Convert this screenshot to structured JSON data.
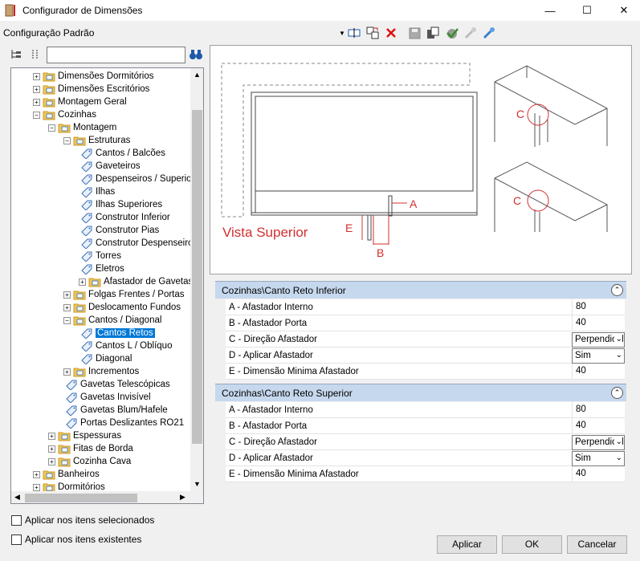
{
  "window": {
    "title": "Configurador de Dimensões",
    "minimize": "—",
    "maximize": "☐",
    "close": "✕"
  },
  "config_label": "Configuração Padrão",
  "tree": {
    "search_value": "",
    "items": [
      {
        "label": "Dimensões Dormitórios",
        "level": 1,
        "exp": "+"
      },
      {
        "label": "Dimensões Escritórios",
        "level": 1,
        "exp": "+"
      },
      {
        "label": "Montagem Geral",
        "level": 1,
        "exp": "+"
      },
      {
        "label": "Cozinhas",
        "level": 1,
        "exp": "−"
      },
      {
        "label": "Montagem",
        "level": 2,
        "exp": "−"
      },
      {
        "label": "Estruturas",
        "level": 3,
        "exp": "−"
      },
      {
        "label": "Cantos / Balcões",
        "level": 4,
        "leaf": true
      },
      {
        "label": "Gaveteiros",
        "level": 4,
        "leaf": true
      },
      {
        "label": "Despenseiros / Superiores",
        "level": 4,
        "leaf": true
      },
      {
        "label": "Ilhas",
        "level": 4,
        "leaf": true
      },
      {
        "label": "Ilhas Superiores",
        "level": 4,
        "leaf": true
      },
      {
        "label": "Construtor Inferior",
        "level": 4,
        "leaf": true
      },
      {
        "label": "Construtor Pias",
        "level": 4,
        "leaf": true
      },
      {
        "label": "Construtor Despenseiros",
        "level": 4,
        "leaf": true
      },
      {
        "label": "Torres",
        "level": 4,
        "leaf": true
      },
      {
        "label": "Eletros",
        "level": 4,
        "leaf": true
      },
      {
        "label": "Afastador de Gavetas",
        "level": 4,
        "exp": "+"
      },
      {
        "label": "Folgas Frentes / Portas",
        "level": 3,
        "exp": "+"
      },
      {
        "label": "Deslocamento Fundos",
        "level": 3,
        "exp": "+"
      },
      {
        "label": "Cantos / Diagonal",
        "level": 3,
        "exp": "−"
      },
      {
        "label": "Cantos Retos",
        "level": 4,
        "leaf": true,
        "selected": true
      },
      {
        "label": "Cantos L / Oblíquo",
        "level": 4,
        "leaf": true
      },
      {
        "label": "Diagonal",
        "level": 4,
        "leaf": true
      },
      {
        "label": "Incrementos",
        "level": 3,
        "exp": "+"
      },
      {
        "label": "Gavetas Telescópicas",
        "level": 3,
        "leaf": true
      },
      {
        "label": "Gavetas Invisível",
        "level": 3,
        "leaf": true
      },
      {
        "label": "Gavetas Blum/Hafele",
        "level": 3,
        "leaf": true
      },
      {
        "label": "Portas Deslizantes RO21",
        "level": 3,
        "leaf": true
      },
      {
        "label": "Espessuras",
        "level": 2,
        "exp": "+"
      },
      {
        "label": "Fitas de Borda",
        "level": 2,
        "exp": "+"
      },
      {
        "label": "Cozinha Cava",
        "level": 2,
        "exp": "+"
      },
      {
        "label": "Banheiros",
        "level": 1,
        "exp": "+"
      },
      {
        "label": "Dormitórios",
        "level": 1,
        "exp": "+"
      }
    ]
  },
  "preview": {
    "vista_label": "Vista Superior",
    "label_a": "A",
    "label_b": "B",
    "label_c": "C",
    "label_e": "E"
  },
  "groups": [
    {
      "title": "Cozinhas\\Canto Reto Inferior",
      "rows": [
        {
          "label": "A - Afastador Interno",
          "value": "80"
        },
        {
          "label": "B - Afastador Porta",
          "value": "40"
        },
        {
          "label": "C - Direção Afastador",
          "value": "Perpendicular",
          "dropdown": true
        },
        {
          "label": "D - Aplicar Afastador",
          "value": "Sim",
          "dropdown": true
        },
        {
          "label": "E - Dimensão Minima Afastador",
          "value": "40"
        }
      ]
    },
    {
      "title": "Cozinhas\\Canto Reto Superior",
      "rows": [
        {
          "label": "A - Afastador Interno",
          "value": "80"
        },
        {
          "label": "B - Afastador Porta",
          "value": "40"
        },
        {
          "label": "C - Direção Afastador",
          "value": "Perpendicular",
          "dropdown": true
        },
        {
          "label": "D - Aplicar Afastador",
          "value": "Sim",
          "dropdown": true
        },
        {
          "label": "E - Dimensão Minima Afastador",
          "value": "40"
        }
      ]
    }
  ],
  "options": {
    "apply_selected": "Aplicar nos itens selecionados",
    "apply_existing": "Aplicar nos itens existentes"
  },
  "buttons": {
    "apply": "Aplicar",
    "ok": "OK",
    "cancel": "Cancelar"
  },
  "colors": {
    "accent": "#0078d7",
    "group_header": "#c6d8ed",
    "drawing_red": "#d23030"
  }
}
